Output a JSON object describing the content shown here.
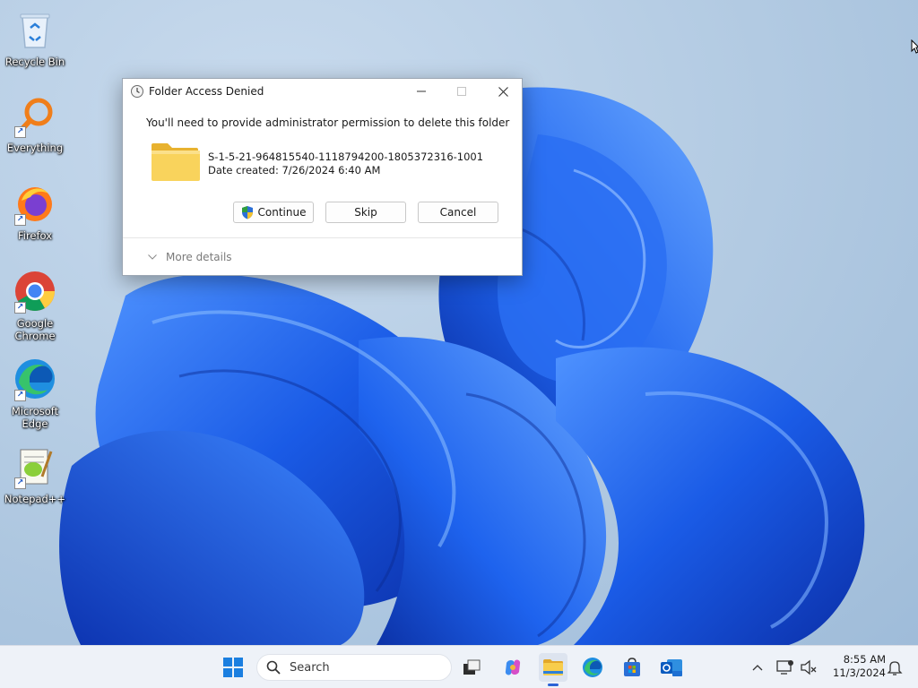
{
  "desktop": {
    "icons": [
      {
        "label": "Recycle Bin",
        "icon": "recycle-bin-icon"
      },
      {
        "label": "Everything",
        "icon": "everything-search-icon"
      },
      {
        "label": "Firefox",
        "icon": "firefox-icon"
      },
      {
        "label": "Google\nChrome",
        "icon": "chrome-icon"
      },
      {
        "label": "Microsoft\nEdge",
        "icon": "edge-icon"
      },
      {
        "label": "Notepad++",
        "icon": "notepadpp-icon"
      }
    ]
  },
  "dialog": {
    "title": "Folder Access Denied",
    "message": "You'll need to provide administrator permission to delete this folder",
    "folder_name": "S-1-5-21-964815540-1118794200-1805372316-1001",
    "folder_date": "Date created: 7/26/2024 6:40 AM",
    "buttons": {
      "continue": "Continue",
      "skip": "Skip",
      "cancel": "Cancel"
    },
    "more_details": "More details"
  },
  "taskbar": {
    "search_label": "Search",
    "apps": [
      "start-icon",
      "task-view-icon",
      "copilot-icon",
      "file-explorer-icon",
      "edge-icon",
      "store-icon",
      "outlook-icon"
    ],
    "clock": {
      "time": "8:55 AM",
      "date": "11/3/2024"
    }
  },
  "colors": {
    "accent": "#2b63d6",
    "folder": "#f7c948",
    "wallpaper_bloom": "#1f5fe0"
  }
}
